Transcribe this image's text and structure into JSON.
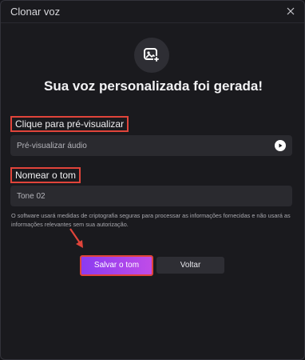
{
  "window": {
    "title": "Clonar voz"
  },
  "icons": {
    "close": "close-icon",
    "avatar": "image-add-icon",
    "play": "play-icon",
    "arrow": "pointer-arrow"
  },
  "headline": "Sua voz personalizada foi gerada!",
  "preview": {
    "label": "Clique para pré-visualizar",
    "field_text": "Pré-visualizar áudio"
  },
  "name": {
    "label": "Nomear o tom",
    "value": "Tone 02"
  },
  "note": "O software usará medidas de criptografia seguras para processar as informações fornecidas e não usará as informações relevantes sem sua autorização.",
  "buttons": {
    "save": "Salvar o tom",
    "back": "Voltar"
  },
  "colors": {
    "highlight": "#e0443a",
    "accent_start": "#8b3bf0",
    "accent_end": "#c04ce8",
    "background": "#1a1a1e"
  }
}
